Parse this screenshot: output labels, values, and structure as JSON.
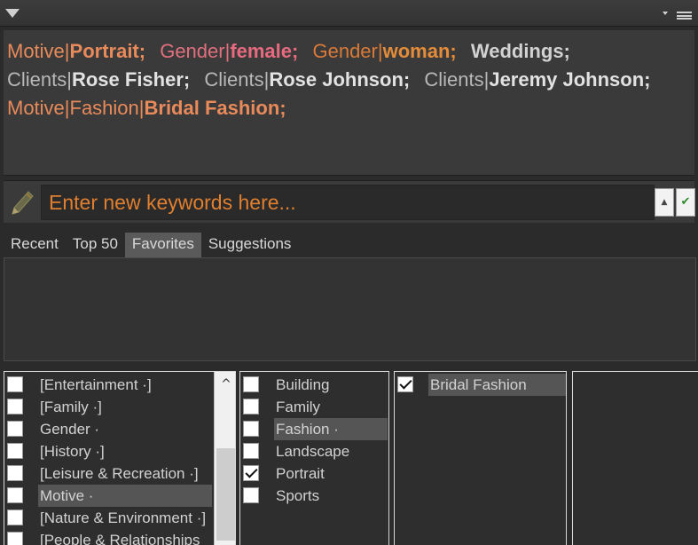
{
  "header": {
    "collapse_icon": "triangle-down-icon",
    "menu_icon": "hamburger-icon"
  },
  "colors": {
    "orange": "#e88a4d",
    "pink": "#e86a7f",
    "gold": "#e48c3a",
    "gray": "#b8b8b8",
    "white": "#e2e2e2",
    "panel": "#3a3a3a",
    "background": "#2b2b2b"
  },
  "keywords": [
    {
      "path": "Motive|",
      "term": "Portrait;",
      "path_color": "#e88a5a",
      "term_color": "#e88a5a"
    },
    {
      "path": "Gender|",
      "term": "female;",
      "path_color": "#e0707e",
      "term_color": "#e86a7f"
    },
    {
      "path": "Gender|",
      "term": "woman;",
      "path_color": "#d97a38",
      "term_color": "#e48c3a"
    },
    {
      "path": "",
      "term": "Weddings;",
      "path_color": "#cfcfcf",
      "term_color": "#d2d2d2"
    },
    {
      "path": "Clients|",
      "term": "Rose Fisher;",
      "path_color": "#b8b8b8",
      "term_color": "#e2e2e2"
    },
    {
      "path": "Clients|",
      "term": "Rose Johnson;",
      "path_color": "#b8b8b8",
      "term_color": "#e2e2e2"
    },
    {
      "path": "Clients|",
      "term": "Jeremy Johnson;",
      "path_color": "#b8b8b8",
      "term_color": "#e2e2e2"
    },
    {
      "path": "Motive|Fashion|",
      "term": "Bridal Fashion;",
      "path_color": "#e88a5a",
      "term_color": "#e88a5a"
    }
  ],
  "entry": {
    "placeholder": "Enter new keywords here...",
    "pencil_icon": "pencil-icon",
    "up_label": "▲",
    "ok_label": "✔"
  },
  "tabs": {
    "items": [
      {
        "label": "Recent",
        "active": false
      },
      {
        "label": "Top 50",
        "active": false
      },
      {
        "label": "Favorites",
        "active": true
      },
      {
        "label": "Suggestions",
        "active": false
      }
    ]
  },
  "columns": {
    "col1": [
      {
        "label": "[Entertainment ·]",
        "checked": false,
        "highlight": false
      },
      {
        "label": "[Family ·]",
        "checked": false,
        "highlight": false
      },
      {
        "label": "Gender ·",
        "checked": false,
        "highlight": false
      },
      {
        "label": "[History ·]",
        "checked": false,
        "highlight": false
      },
      {
        "label": "[Leisure & Recreation ·]",
        "checked": false,
        "highlight": false
      },
      {
        "label": "Motive ·",
        "checked": false,
        "highlight": true
      },
      {
        "label": "[Nature & Environment ·]",
        "checked": false,
        "highlight": false
      },
      {
        "label": "[People & Relationships",
        "checked": false,
        "highlight": false
      }
    ],
    "col2": [
      {
        "label": "Building",
        "checked": false,
        "highlight": false
      },
      {
        "label": "Family",
        "checked": false,
        "highlight": false
      },
      {
        "label": "Fashion ·",
        "checked": false,
        "highlight": true
      },
      {
        "label": "Landscape",
        "checked": false,
        "highlight": false
      },
      {
        "label": "Portrait",
        "checked": true,
        "highlight": false
      },
      {
        "label": "Sports",
        "checked": false,
        "highlight": false
      }
    ],
    "col3": [
      {
        "label": "Bridal Fashion",
        "checked": true,
        "highlight": true
      }
    ],
    "scroll_up_label": "^"
  }
}
